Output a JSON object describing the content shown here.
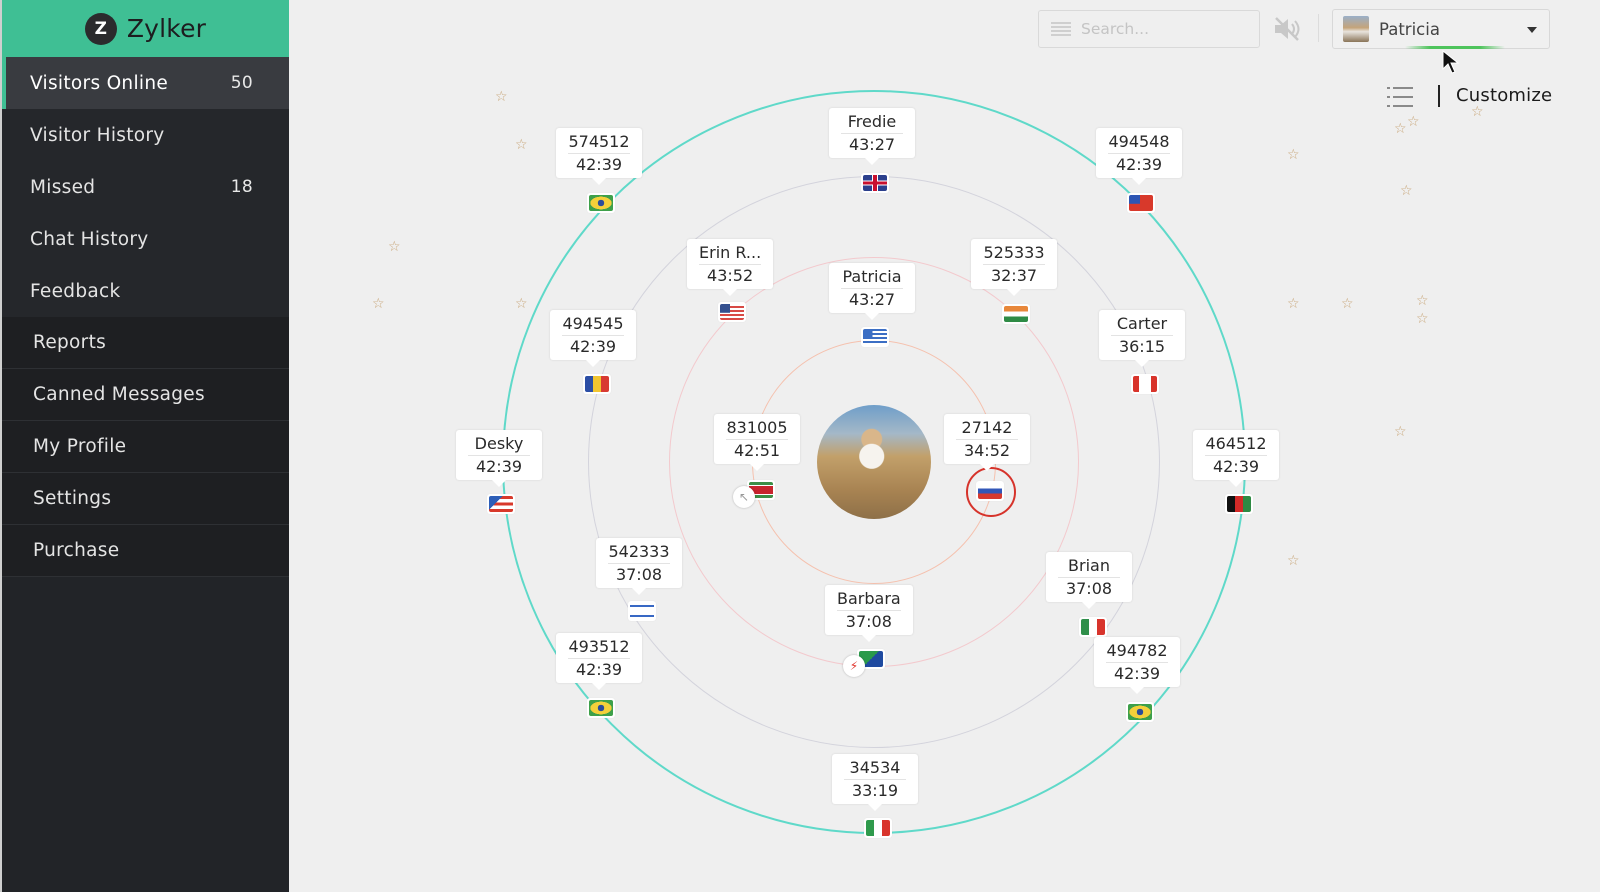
{
  "brand": {
    "logo_letter": "Z",
    "name": "Zylker"
  },
  "sidebar": {
    "items": [
      {
        "label": "Visitors Online",
        "count": "50",
        "active": true
      },
      {
        "label": "Visitor History",
        "count": ""
      },
      {
        "label": "Missed",
        "count": "18"
      },
      {
        "label": "Chat History",
        "count": ""
      },
      {
        "label": "Feedback",
        "count": ""
      }
    ],
    "secondary_items": [
      {
        "label": "Reports"
      },
      {
        "label": "Canned Messages"
      },
      {
        "label": "My Profile"
      },
      {
        "label": "Settings"
      },
      {
        "label": "Purchase"
      }
    ]
  },
  "topbar": {
    "search_placeholder": "Search...",
    "mute_icon": "speaker-muted-icon",
    "user_name": "Patricia",
    "customize_label": "Customize"
  },
  "operator": {
    "name": "Patricia"
  },
  "visitors": [
    {
      "name": "Fredie",
      "time": "43:27",
      "flag": "uk",
      "ring": "gray"
    },
    {
      "name": "574512",
      "time": "42:39",
      "flag": "brazil",
      "ring": "outer"
    },
    {
      "name": "494548",
      "time": "42:39",
      "flag": "samoa",
      "ring": "outer"
    },
    {
      "name": "Erin R...",
      "time": "43:52",
      "flag": "usa",
      "ring": "pink"
    },
    {
      "name": "525333",
      "time": "32:37",
      "flag": "india",
      "ring": "pink"
    },
    {
      "name": "Patricia",
      "time": "43:27",
      "flag": "greece",
      "ring": "inner"
    },
    {
      "name": "494545",
      "time": "42:39",
      "flag": "andorra",
      "ring": "gray"
    },
    {
      "name": "Carter",
      "time": "36:15",
      "flag": "canada",
      "ring": "gray"
    },
    {
      "name": "831005",
      "time": "42:51",
      "flag": "suriname",
      "ring": "inner",
      "badge": "cursor"
    },
    {
      "name": "27142",
      "time": "34:52",
      "flag": "russia",
      "ring": "inner",
      "highlighted": true
    },
    {
      "name": "Desky",
      "time": "42:39",
      "flag": "puerto-rico",
      "ring": "outer"
    },
    {
      "name": "464512",
      "time": "42:39",
      "flag": "afghanistan",
      "ring": "outer"
    },
    {
      "name": "542333",
      "time": "37:08",
      "flag": "israel",
      "ring": "gray"
    },
    {
      "name": "Barbara",
      "time": "37:08",
      "flag": "christmas-island",
      "ring": "pink",
      "badge": "lightning"
    },
    {
      "name": "Brian",
      "time": "37:08",
      "flag": "mexico",
      "ring": "gray"
    },
    {
      "name": "493512",
      "time": "42:39",
      "flag": "brazil",
      "ring": "outer"
    },
    {
      "name": "494782",
      "time": "42:39",
      "flag": "brazil",
      "ring": "outer"
    },
    {
      "name": "34534",
      "time": "33:19",
      "flag": "italy",
      "ring": "outer"
    }
  ],
  "colors": {
    "brand_green": "#3fbf94",
    "outer_ring": "#5fd9c9",
    "gray_ring": "#d3d3dc",
    "pink_ring": "#f3c9cd",
    "inner_ring": "#f5c1ae",
    "highlight": "#d6332b"
  }
}
